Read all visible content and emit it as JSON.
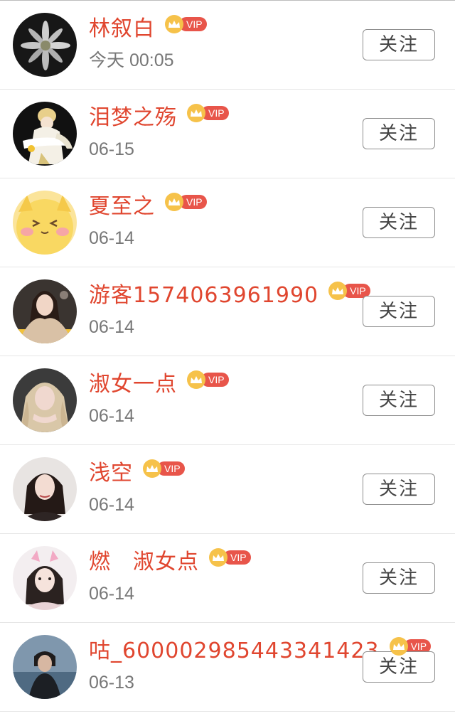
{
  "follow_label": "关注",
  "vip_label": "VIP",
  "colors": {
    "name": "#e0462f",
    "time": "#777777",
    "vip_tag": "#e8554a",
    "vip_crown": "#f6c24a",
    "button_border": "#8e8e8e"
  },
  "users": [
    {
      "name": "林叙白",
      "time": "今天 00:05"
    },
    {
      "name": "泪梦之殇",
      "time": "06-15"
    },
    {
      "name": "夏至之",
      "time": "06-14"
    },
    {
      "name": "游客1574063961990",
      "time": "06-14"
    },
    {
      "name": "淑女一点",
      "time": "06-14"
    },
    {
      "name": "浅空",
      "time": "06-14"
    },
    {
      "name": "燃　淑女点",
      "time": "06-14"
    },
    {
      "name": "咕_600002985443341423",
      "time": "06-13"
    }
  ]
}
